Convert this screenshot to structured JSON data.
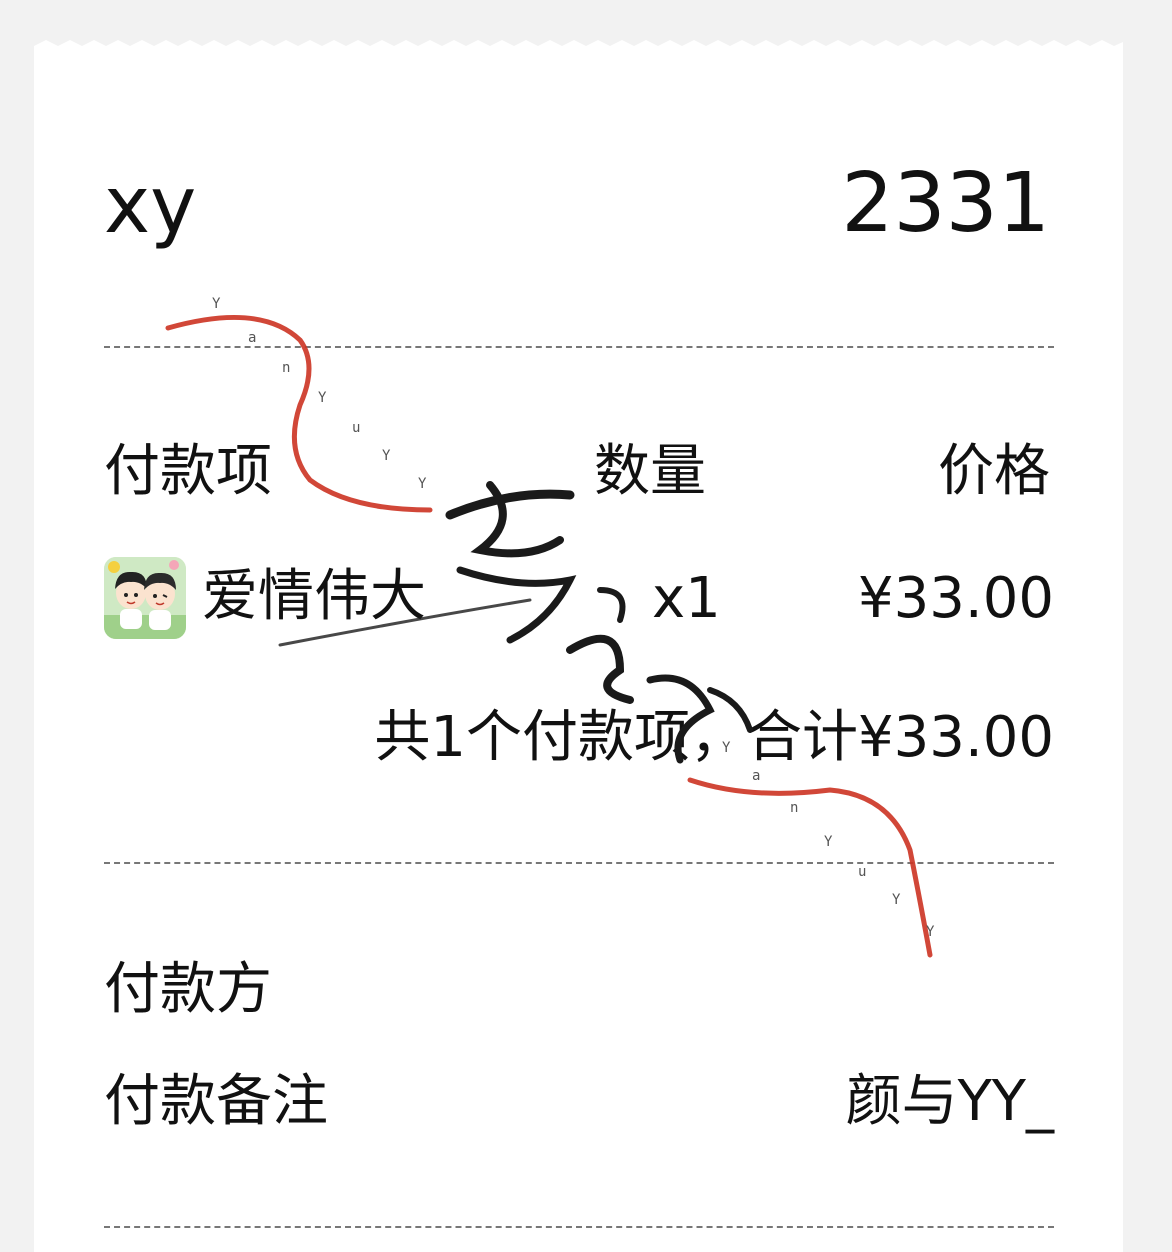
{
  "header": {
    "store_name": "xy",
    "order_number": "2331"
  },
  "columns": {
    "item": "付款项",
    "quantity": "数量",
    "price": "价格"
  },
  "items": [
    {
      "name": "爱情伟大",
      "quantity": "x1",
      "price": "¥33.00",
      "thumbnail_icon": "anime-couple-avatar"
    }
  ],
  "summary": {
    "total_text": "共1个付款项，合计¥33.00"
  },
  "payer": {
    "label": "付款方",
    "value": ""
  },
  "note": {
    "label": "付款备注",
    "value": "颜与YY_"
  },
  "watermark": {
    "text": "颜与YY",
    "small_text": "YanYuYY"
  },
  "colors": {
    "background": "#f2f2f2",
    "paper": "#ffffff",
    "text": "#111111",
    "stamp_red": "#cc3322",
    "stamp_ink": "#1a1a1a"
  }
}
